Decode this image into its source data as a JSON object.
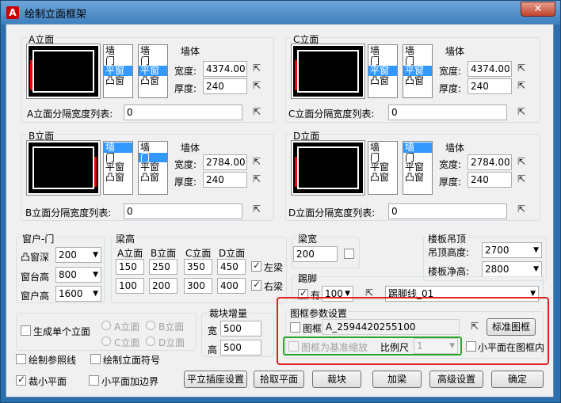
{
  "window": {
    "title": "绘制立面框架",
    "icon": "A",
    "close": "✕"
  },
  "elev_a": {
    "legend": "A立面",
    "list": [
      "墙",
      "门",
      "平窗",
      "凸窗"
    ],
    "wall_label": "墙体",
    "width_label": "宽度:",
    "width": "4374.00",
    "thick_label": "厚度:",
    "thick": "240",
    "split_label": "A立面分隔宽度列表:",
    "split": "0"
  },
  "elev_c": {
    "legend": "C立面",
    "list": [
      "墙",
      "门",
      "平窗",
      "凸窗"
    ],
    "wall_label": "墙体",
    "width_label": "宽度:",
    "width": "4374.00",
    "thick_label": "厚度:",
    "thick": "240",
    "split_label": "C立面分隔宽度列表:",
    "split": "0"
  },
  "elev_b": {
    "legend": "B立面",
    "list": [
      "墙",
      "门",
      "平窗",
      "凸窗"
    ],
    "wall_label": "墙体",
    "width_label": "宽度:",
    "width": "2784.00",
    "thick_label": "厚度:",
    "thick": "240",
    "split_label": "B立面分隔宽度列表:",
    "split": "0"
  },
  "elev_d": {
    "legend": "D立面",
    "list": [
      "墙",
      "门",
      "平窗",
      "凸窗"
    ],
    "wall_label": "墙体",
    "width_label": "宽度:",
    "width": "2784.00",
    "thick_label": "厚度:",
    "thick": "240",
    "split_label": "D立面分隔宽度列表:",
    "split": "0"
  },
  "window_door": {
    "legend": "窗户-门",
    "bay_depth_label": "凸窗深",
    "bay_depth": "200",
    "sill_label": "窗台高",
    "sill": "800",
    "win_height_label": "窗户高",
    "win_height": "1600"
  },
  "beam": {
    "legend": "梁高",
    "cols": [
      "A立面",
      "B立面",
      "C立面",
      "D立面"
    ],
    "row1": [
      "150",
      "250",
      "350",
      "450"
    ],
    "row2": [
      "100",
      "200",
      "300",
      "400"
    ],
    "left_beam": "左梁",
    "right_beam": "右梁"
  },
  "beam_width": {
    "legend": "梁宽",
    "value": "200"
  },
  "ceiling": {
    "legend": "楼板吊顶",
    "ceil_height_label": "吊顶高度:",
    "ceil_height": "2700",
    "floor_clear_label": "楼板净高:",
    "floor_clear": "2800"
  },
  "skirting": {
    "legend": "踢脚",
    "has_label": "有",
    "height": "100",
    "line": "踢脚线_01"
  },
  "tile": {
    "legend": "裁块增量",
    "width_label": "宽",
    "width": "500",
    "height_label": "高",
    "height": "500"
  },
  "single": {
    "label": "生成单个立面",
    "opts": [
      "A立面",
      "B立面",
      "C立面",
      "D立面"
    ]
  },
  "frame": {
    "legend": "图框参数设置",
    "frame_label": "图框",
    "frame_name": "A_2594420255100",
    "std_button": "标准图框",
    "scale_base": "图框为基准缩放",
    "scale_label": "比例尺",
    "scale": "1",
    "small_plane_in_frame": "小平面在图框内"
  },
  "options": {
    "ref_line": "绘制参照线",
    "elev_symbol": "绘制立面符号",
    "crop_small": "裁小平面",
    "small_border": "小平面加边界"
  },
  "buttons": [
    "平立插座设置",
    "拾取平面",
    "裁块",
    "加梁",
    "高级设置",
    "确定"
  ],
  "colors": {
    "highlight_red": "#e02020",
    "highlight_green": "#2aa52a"
  }
}
